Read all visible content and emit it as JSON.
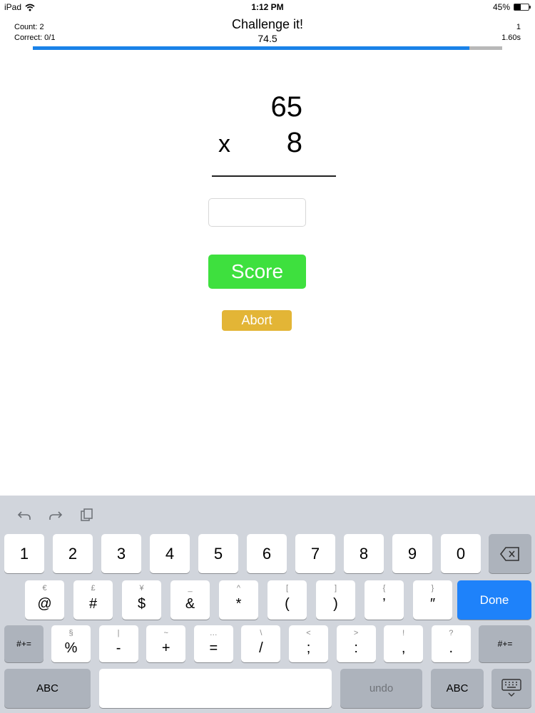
{
  "status": {
    "device": "iPad",
    "time": "1:12 PM",
    "battery": "45%",
    "battery_level": 0.45
  },
  "header": {
    "count": "Count: 2",
    "correct": "Correct: 0/1",
    "title": "Challenge it!",
    "score": "74.5",
    "right_top": "1",
    "timer": "1.60s",
    "progress": 0.93
  },
  "problem": {
    "operand1": "65",
    "operator": "x",
    "operand2": "8"
  },
  "answer": {
    "value": ""
  },
  "buttons": {
    "score": "Score",
    "abort": "Abort"
  },
  "colors": {
    "progress": "#1a82e8",
    "score_button": "#3ee03e",
    "abort_button": "#e3b536",
    "done_key": "#1e82fa"
  },
  "keyboard": {
    "shortcut_icons": [
      "undo-icon",
      "redo-icon",
      "paste-icon"
    ],
    "row1": [
      "1",
      "2",
      "3",
      "4",
      "5",
      "6",
      "7",
      "8",
      "9",
      "0"
    ],
    "row2": [
      {
        "main": "@",
        "alt": "€"
      },
      {
        "main": "#",
        "alt": "£"
      },
      {
        "main": "$",
        "alt": "¥"
      },
      {
        "main": "&",
        "alt": "_"
      },
      {
        "main": "*",
        "alt": "^"
      },
      {
        "main": "(",
        "alt": "["
      },
      {
        "main": ")",
        "alt": "]"
      },
      {
        "main": "’",
        "alt": "{"
      },
      {
        "main": "″",
        "alt": "}"
      }
    ],
    "row3": [
      {
        "main": "%",
        "alt": "§"
      },
      {
        "main": "-",
        "alt": "|"
      },
      {
        "main": "+",
        "alt": "~"
      },
      {
        "main": "=",
        "alt": "…"
      },
      {
        "main": "/",
        "alt": "\\"
      },
      {
        "main": ";",
        "alt": "<"
      },
      {
        "main": ":",
        "alt": ">"
      },
      {
        "main": ",",
        "alt": "!"
      },
      {
        "main": ".",
        "alt": "?"
      }
    ],
    "done": "Done",
    "symbols": "#+=",
    "abc": "ABC",
    "undo": "undo",
    "delete_icon": "backspace-icon",
    "dismiss_icon": "keyboard-dismiss-icon"
  }
}
